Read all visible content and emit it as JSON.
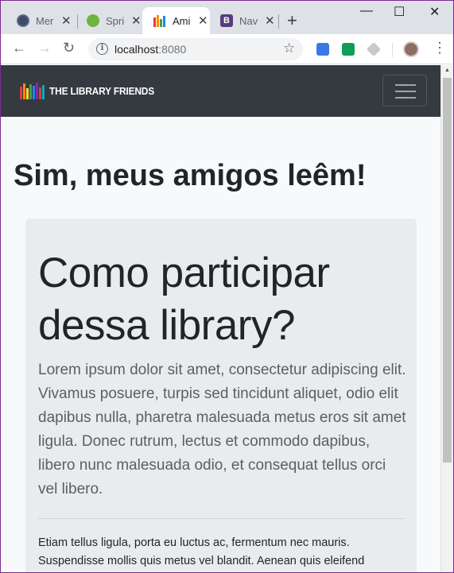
{
  "browser": {
    "tabs": [
      {
        "title": "Mer",
        "favicon": "dark-circle-icon",
        "active": false
      },
      {
        "title": "Spri",
        "favicon": "spring-leaf-icon",
        "active": false
      },
      {
        "title": "Ami",
        "favicon": "books-icon",
        "active": true
      },
      {
        "title": "Nav",
        "favicon": "bootstrap-b-icon",
        "active": false
      }
    ],
    "close_glyph": "✕",
    "new_tab_glyph": "+",
    "window_controls": {
      "minimize": "—",
      "maximize": "☐",
      "close": "✕"
    },
    "address_bar": {
      "host": "localhost",
      "port": ":8080"
    },
    "info_glyph": "i",
    "bootstrap_glyph": "B"
  },
  "navbar": {
    "brand_text": "THE LIBRARY FRIENDS",
    "background": "#343a40"
  },
  "page": {
    "title": "Sim, meus amigos leêm!"
  },
  "jumbotron": {
    "heading": "Como participar dessa library?",
    "lead": "Lorem ipsum dolor sit amet, consectetur adipiscing elit. Vivamus posuere, turpis sed tincidunt aliquet, odio elit dapibus nulla, pharetra malesuada metus eros sit amet ligula. Donec rutrum, lectus et commodo dapibus, libero nunc malesuada odio, et consequat tellus orci vel libero.",
    "body": "Etiam tellus ligula, porta eu luctus ac, fermentum nec mauris. Suspendisse mollis quis metus vel blandit. Aenean quis eleifend",
    "background": "#e9ecef"
  }
}
